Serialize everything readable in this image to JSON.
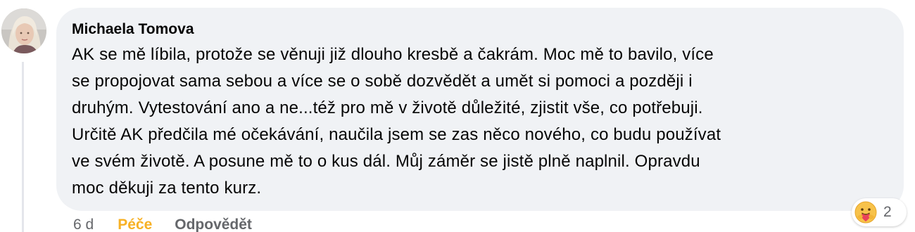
{
  "comment": {
    "author": "Michaela Tomova",
    "text_lines": [
      "AK se mě líbila, protože se věnuji již dlouho kresbě a čakrám. Moc mě to bavilo, více",
      "se propojovat sama sebou a více se o sobě dozvědět a umět si pomoci a později i",
      "druhým. Vytestování ano a ne...též pro mě v životě důležité, zjistit vše, co potřebuji.",
      "Určitě AK předčila mé očekávání, naučila jsem se zas něco nového, co budu používat",
      "ve svém životě. A posune mě to o kus dál. Můj záměr se jistě plně naplnil. Opravdu",
      "moc děkuji za tento kurz."
    ],
    "reaction": {
      "icon": "care-reaction-icon",
      "count": "2"
    },
    "actions": {
      "timestamp": "6 d",
      "care_label": "Péče",
      "reply_label": "Odpovědět"
    }
  },
  "colors": {
    "bubble": "#f0f2f5",
    "text": "#050505",
    "secondary": "#65676b",
    "care": "#f7b125",
    "thread_line": "#e4e6eb"
  }
}
